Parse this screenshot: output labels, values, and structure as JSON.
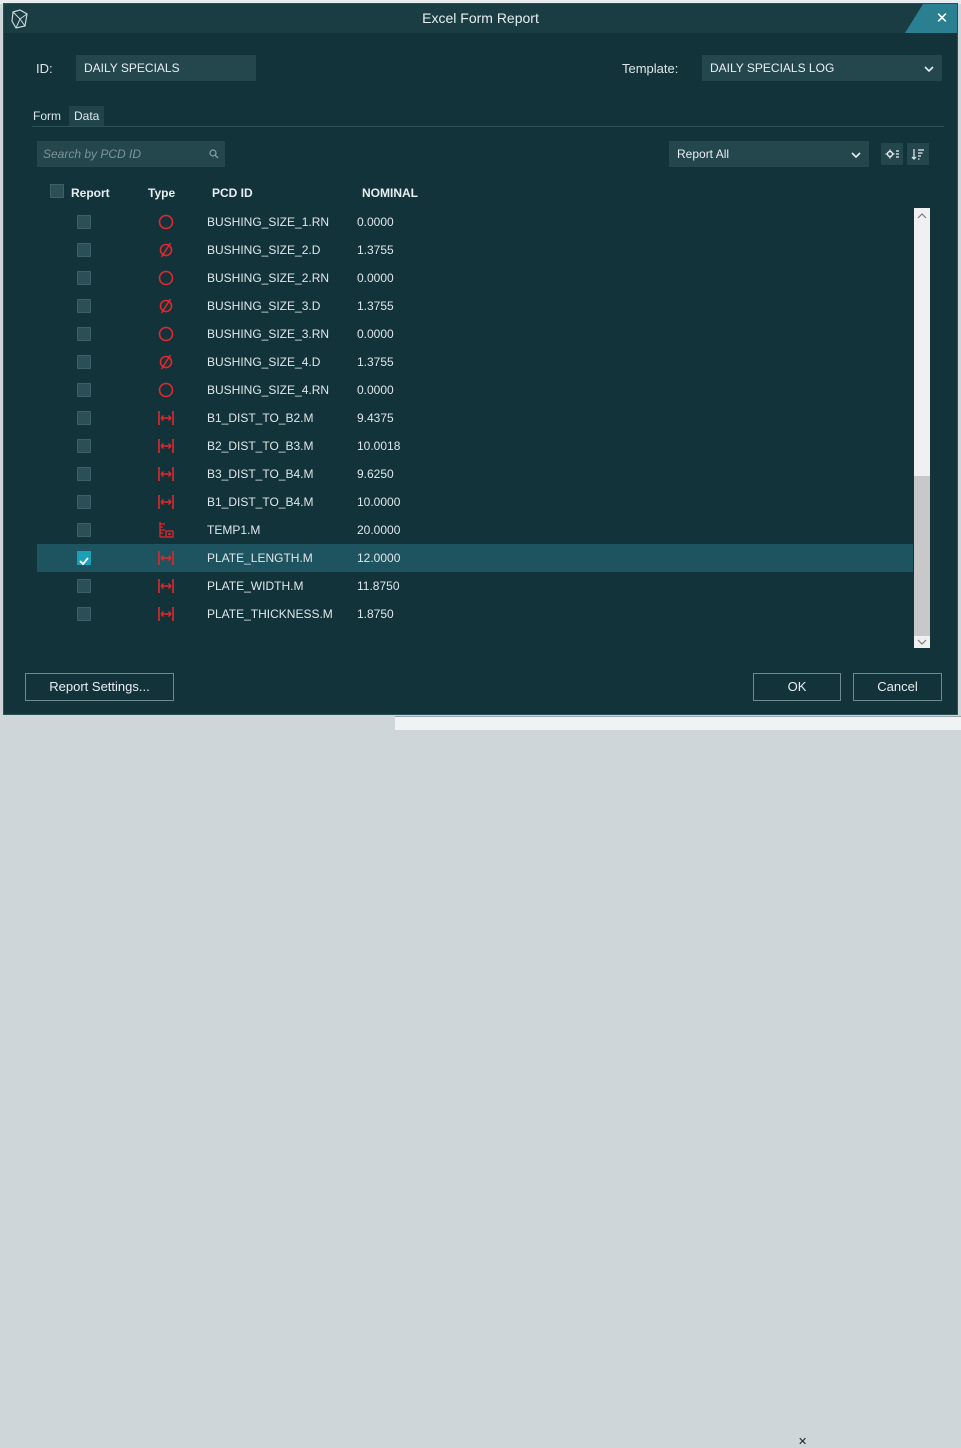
{
  "window": {
    "title": "Excel Form Report",
    "close_glyph": "✕"
  },
  "form": {
    "id_label": "ID:",
    "id_value": "DAILY SPECIALS",
    "template_label": "Template:",
    "template_value": "DAILY SPECIALS LOG"
  },
  "tabs": [
    {
      "label": "Form"
    },
    {
      "label": "Data"
    }
  ],
  "toolbar": {
    "search_placeholder": "Search by PCD ID",
    "report_filter": "Report All"
  },
  "table": {
    "headers": {
      "report": "Report",
      "type": "Type",
      "pcd_id": "PCD ID",
      "nominal": "NOMINAL"
    },
    "rows": [
      {
        "type": "roundness",
        "pcd_id": "BUSHING_SIZE_1.RN",
        "nominal": "0.0000",
        "checked": false
      },
      {
        "type": "diameter",
        "pcd_id": "BUSHING_SIZE_2.D",
        "nominal": "1.3755",
        "checked": false
      },
      {
        "type": "roundness",
        "pcd_id": "BUSHING_SIZE_2.RN",
        "nominal": "0.0000",
        "checked": false
      },
      {
        "type": "diameter",
        "pcd_id": "BUSHING_SIZE_3.D",
        "nominal": "1.3755",
        "checked": false
      },
      {
        "type": "roundness",
        "pcd_id": "BUSHING_SIZE_3.RN",
        "nominal": "0.0000",
        "checked": false
      },
      {
        "type": "diameter",
        "pcd_id": "BUSHING_SIZE_4.D",
        "nominal": "1.3755",
        "checked": false
      },
      {
        "type": "roundness",
        "pcd_id": "BUSHING_SIZE_4.RN",
        "nominal": "0.0000",
        "checked": false
      },
      {
        "type": "distance",
        "pcd_id": "B1_DIST_TO_B2.M",
        "nominal": "9.4375",
        "checked": false
      },
      {
        "type": "distance",
        "pcd_id": "B2_DIST_TO_B3.M",
        "nominal": "10.0018",
        "checked": false
      },
      {
        "type": "distance",
        "pcd_id": "B3_DIST_TO_B4.M",
        "nominal": "9.6250",
        "checked": false
      },
      {
        "type": "distance",
        "pcd_id": "B1_DIST_TO_B4.M",
        "nominal": "10.0000",
        "checked": false
      },
      {
        "type": "temperature",
        "pcd_id": "TEMP1.M",
        "nominal": "20.0000",
        "checked": false
      },
      {
        "type": "distance",
        "pcd_id": "PLATE_LENGTH.M",
        "nominal": "12.0000",
        "checked": true,
        "selected": true
      },
      {
        "type": "distance",
        "pcd_id": "PLATE_WIDTH.M",
        "nominal": "11.8750",
        "checked": false
      },
      {
        "type": "distance",
        "pcd_id": "PLATE_THICKNESS.M",
        "nominal": "1.8750",
        "checked": false
      }
    ]
  },
  "footer": {
    "report_settings_label": "Report Settings...",
    "ok_label": "OK",
    "cancel_label": "Cancel"
  },
  "colors": {
    "background": "#13333a",
    "field": "#24474e",
    "accent": "#2a7f90",
    "selected_row": "#1e5360",
    "type_icon": "#e0282e",
    "check": "#1aa0b8"
  }
}
